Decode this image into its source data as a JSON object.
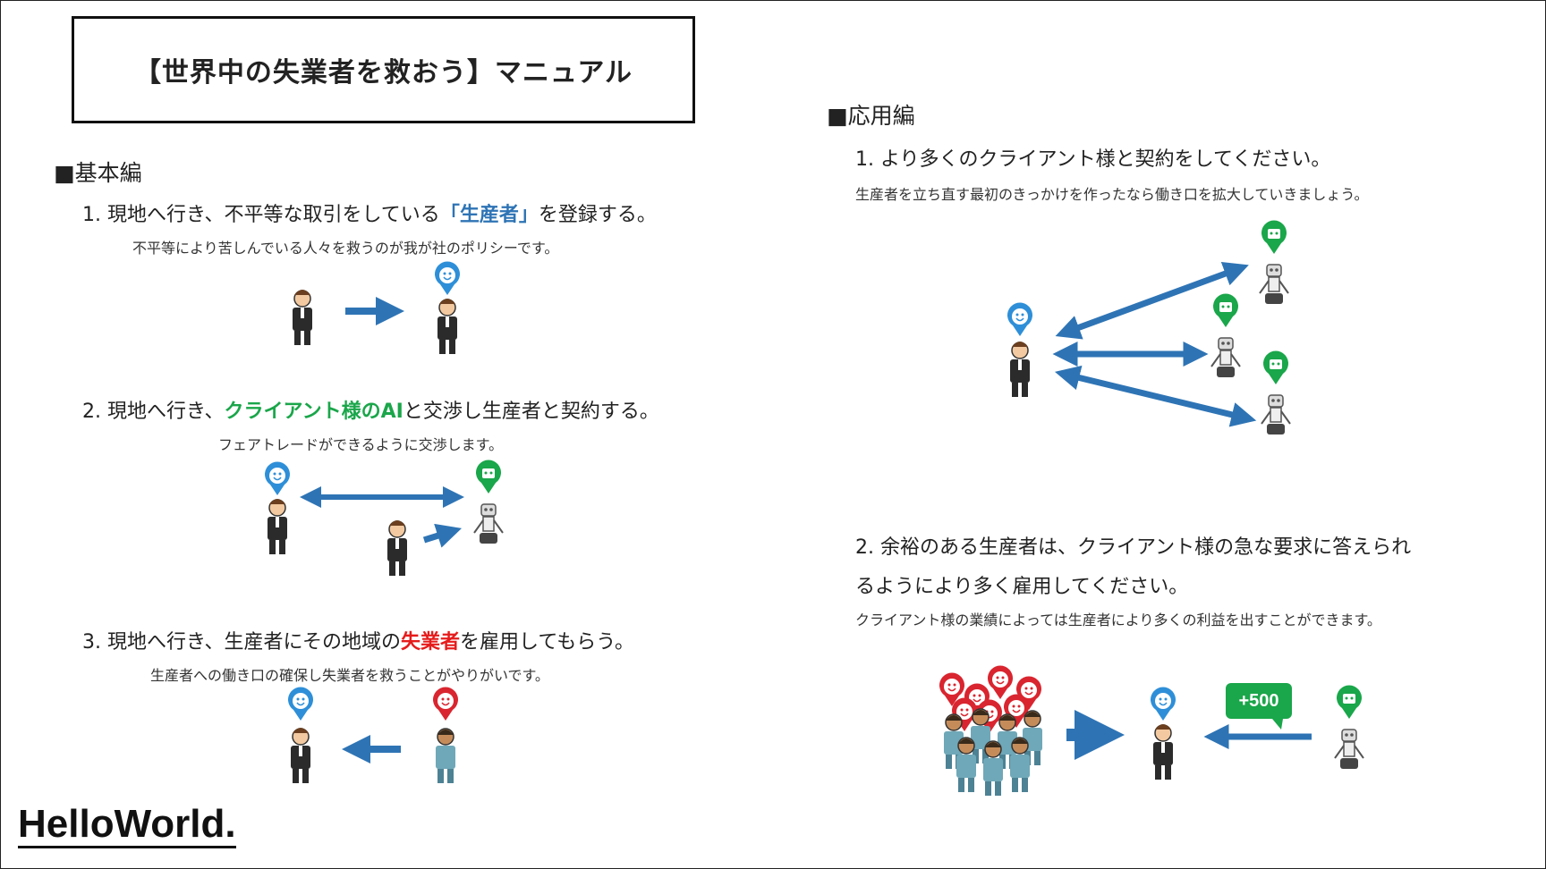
{
  "title": "【世界中の失業者を救おう】マニュアル",
  "basic": {
    "heading": "■基本編",
    "steps": [
      {
        "num": "1.",
        "pre": "現地へ行き、不平等な取引をしている",
        "highlight": "「生産者」",
        "post": "を登録する。",
        "note": "不平等により苦しんでいる人々を救うのが我が社のポリシーです。"
      },
      {
        "num": "2.",
        "pre": "現地へ行き、",
        "highlight": "クライアント様のAI",
        "post": "と交渉し生産者と契約する。",
        "note": "フェアトレードができるように交渉します。"
      },
      {
        "num": "3.",
        "pre": "現地へ行き、生産者にその地域の",
        "highlight": "失業者",
        "post": "を雇用してもらう。",
        "note": "生産者への働き口の確保し失業者を救うことがやりがいです。"
      }
    ]
  },
  "applied": {
    "heading": "■応用編",
    "steps": [
      {
        "num": "1.",
        "text": "より多くのクライアント様と契約をしてください。",
        "note": "生産者を立ち直す最初のきっかけを作ったなら働き口を拡大していきましょう。"
      },
      {
        "num": "2.",
        "text": "余裕のある生産者は、クライアント様の急な要求に答えられ",
        "text2": "るようにより多く雇用してください。",
        "note": "クライアント様の業績によっては生産者により多くの利益を出すことができます。"
      }
    ],
    "badge": "+500"
  },
  "logo": "HelloWorld.",
  "colors": {
    "blue": "#2e74b5",
    "green": "#1aa64a",
    "red": "#e51c1c",
    "arrow": "#2e74b5"
  }
}
